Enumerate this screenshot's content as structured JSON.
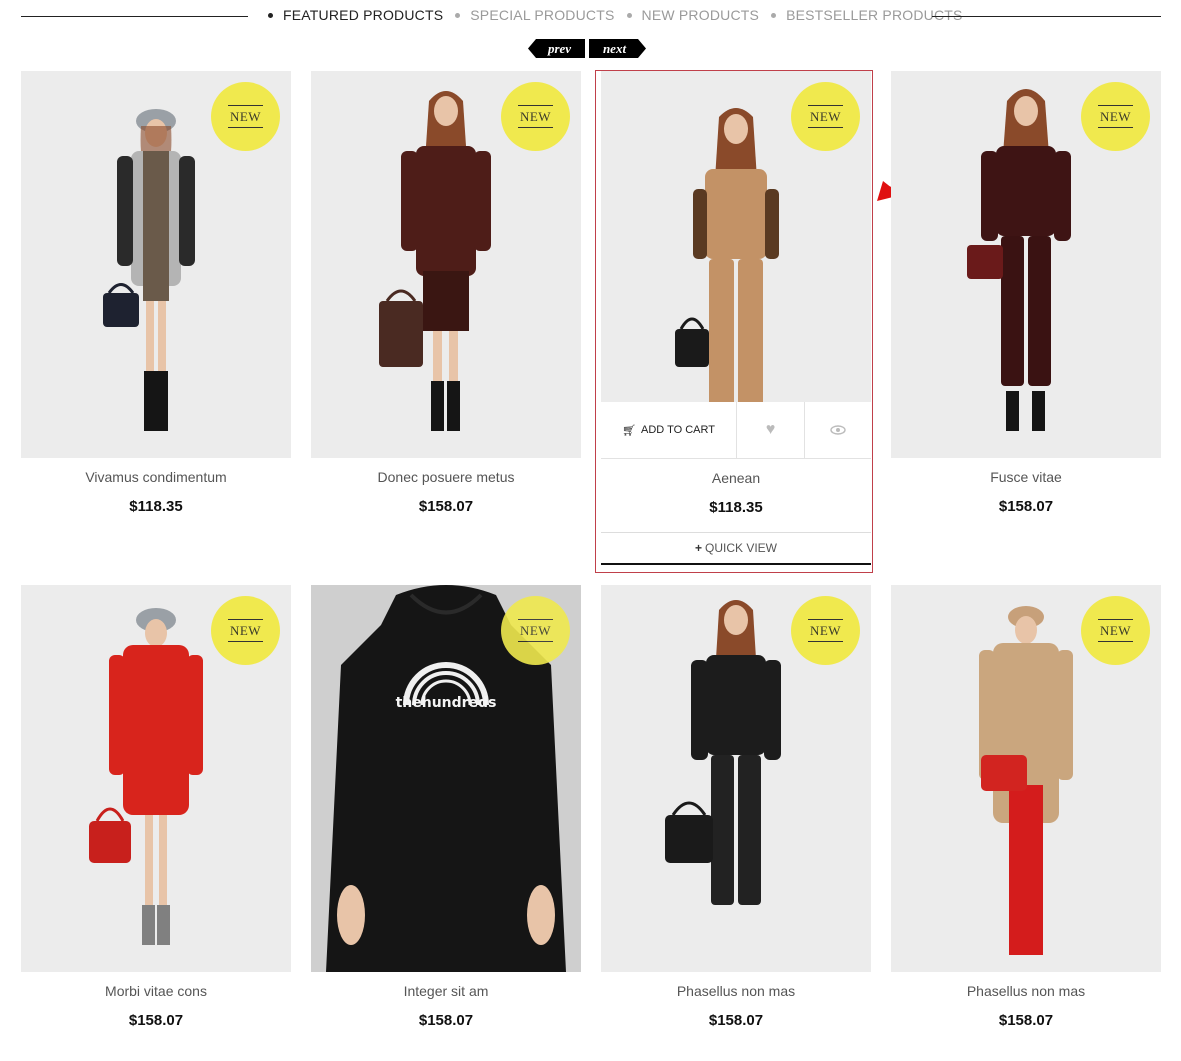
{
  "tabs": [
    {
      "label": "FEATURED PRODUCTS",
      "active": true
    },
    {
      "label": "SPECIAL PRODUCTS",
      "active": false
    },
    {
      "label": "NEW PRODUCTS",
      "active": false
    },
    {
      "label": "BESTSELLER PRODUCTS",
      "active": false
    }
  ],
  "carousel": {
    "prev": "prev",
    "next": "next"
  },
  "badge": "NEW",
  "products_row1": [
    {
      "name": "Vivamus condimentum",
      "price": "$118.35"
    },
    {
      "name": "Donec posuere metus",
      "price": "$158.07"
    },
    {
      "name": "Aenean",
      "price": "$118.35",
      "add_to_cart": "ADD TO CART",
      "quick_view": "QUICK VIEW"
    },
    {
      "name": "Fusce vitae",
      "price": "$158.07"
    }
  ],
  "products_row2": [
    {
      "name": "Morbi vitae cons",
      "price": "$158.07"
    },
    {
      "name": "Integer sit am",
      "price": "$158.07",
      "print": "thehundreds"
    },
    {
      "name": "Phasellus non mas",
      "price": "$158.07"
    },
    {
      "name": "Phasellus non mas",
      "price": "$158.07"
    }
  ],
  "colors": {
    "badge": "#f0e94e",
    "hover_border": "#c0404a",
    "arrow": "#e01010"
  }
}
